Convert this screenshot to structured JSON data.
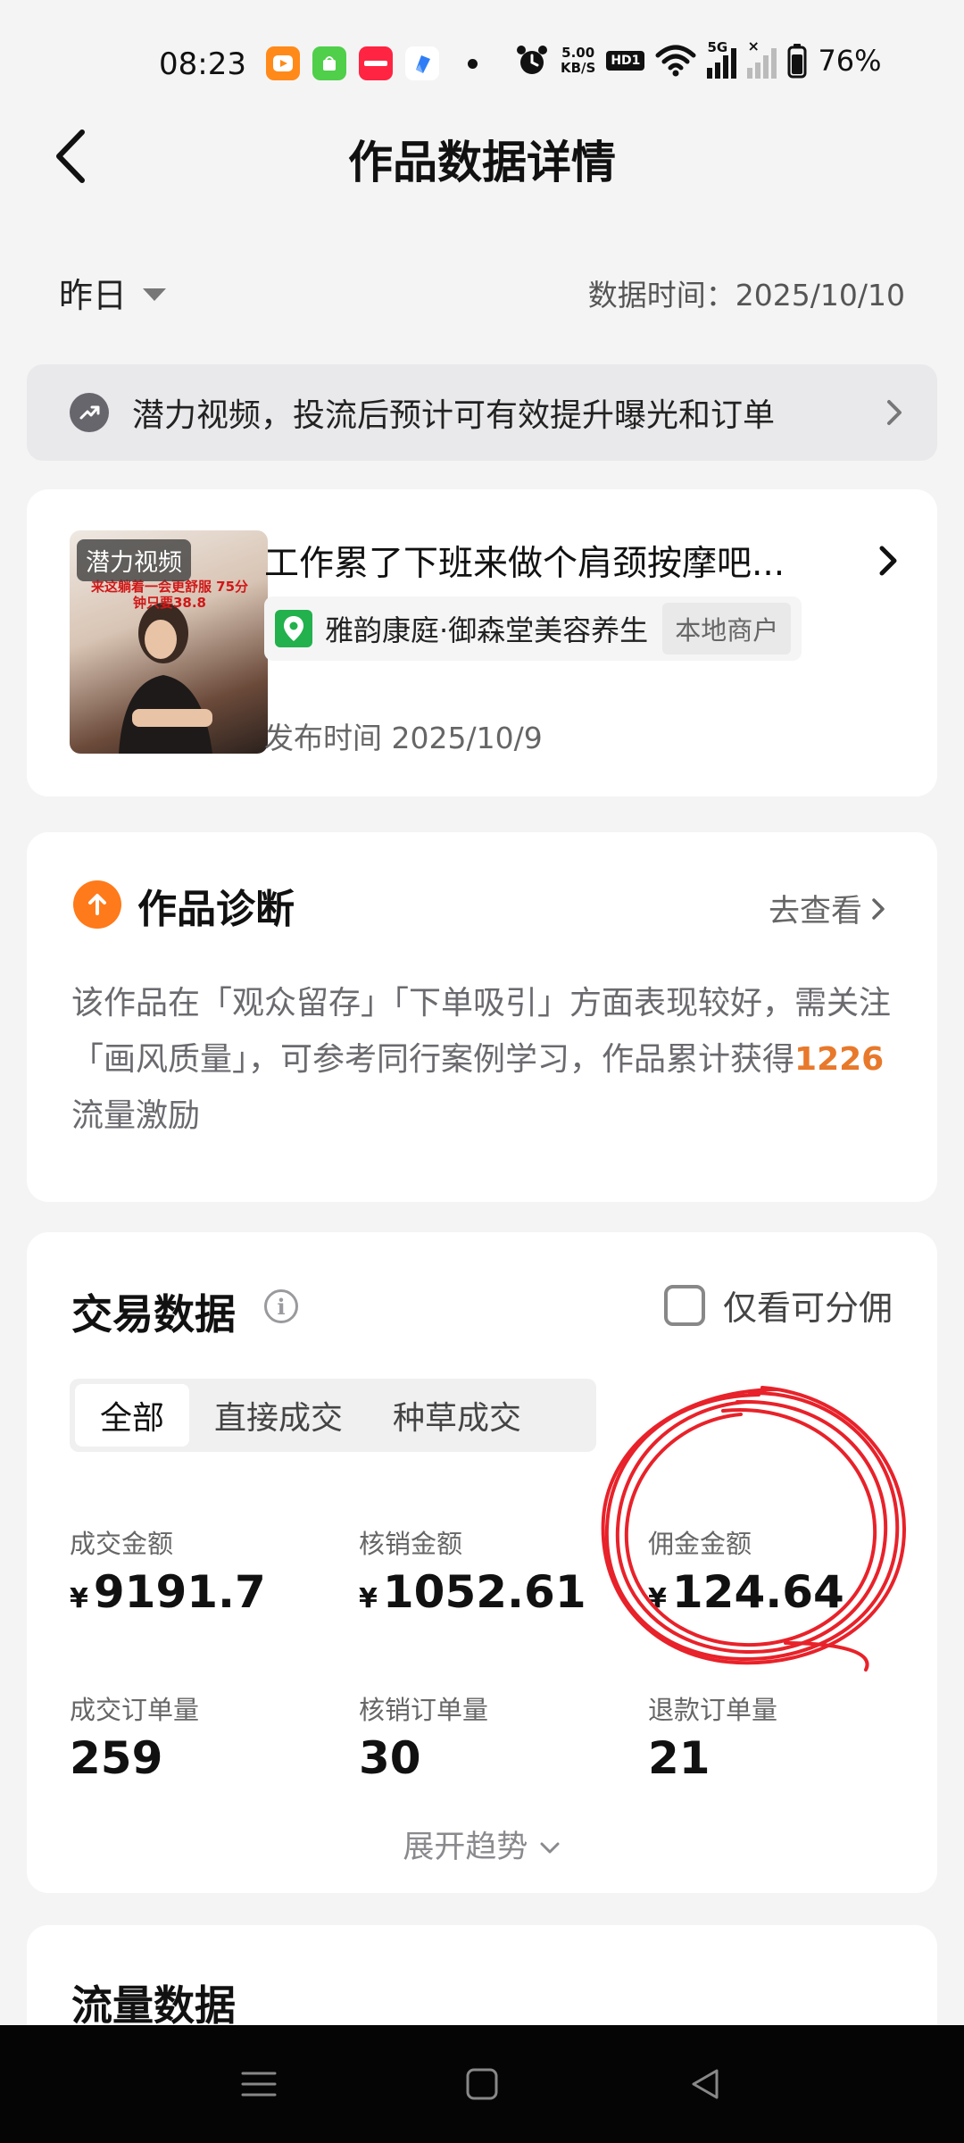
{
  "status_bar": {
    "time": "08:23",
    "net_speed_value": "5.00",
    "net_speed_unit": "KB/S",
    "hd_label": "HD1",
    "signal_label": "5G",
    "battery_text": "76%",
    "app_icons": [
      "video-app-icon",
      "green-app-icon",
      "xiaohongshu-icon",
      "blue-app-icon"
    ]
  },
  "header": {
    "title": "作品数据详情"
  },
  "filter": {
    "period": "昨日",
    "data_time": "数据时间：2025/10/10"
  },
  "banner": {
    "text": "潜力视频，投流后预计可有效提升曝光和订单"
  },
  "video": {
    "thumb_tag": "潜力视频",
    "thumb_caption": "来这躺着一会更舒服 75分钟只要38.8",
    "title": "工作累了下班来做个肩颈按摩吧...",
    "poi_name": "雅韵康庭·御森堂美容养生",
    "poi_tag": "本地商户",
    "publish_time": "发布时间 2025/10/9"
  },
  "diagnosis": {
    "title": "作品诊断",
    "link": "去查看",
    "body_prefix": "该作品在「观众留存」「下单吸引」方面表现较好，需关注「画风质量」，可参考同行案例学习，作品累计获得",
    "highlight": "1226",
    "body_suffix": "流量激励"
  },
  "trade": {
    "title": "交易数据",
    "checkbox_label": "仅看可分佣",
    "tabs": [
      {
        "label": "全部"
      },
      {
        "label": "直接成交"
      },
      {
        "label": "种草成交"
      }
    ],
    "currency": "¥",
    "metrics": [
      {
        "label": "成交金额",
        "value": "9191.7"
      },
      {
        "label": "核销金额",
        "value": "1052.61"
      },
      {
        "label": "佣金金额",
        "value": "124.64"
      },
      {
        "label": "成交订单量",
        "value": "259"
      },
      {
        "label": "核销订单量",
        "value": "30"
      },
      {
        "label": "退款订单量",
        "value": "21"
      }
    ],
    "expand": "展开趋势",
    "annotation_color": "#e8222a"
  },
  "traffic": {
    "title": "流量数据"
  }
}
